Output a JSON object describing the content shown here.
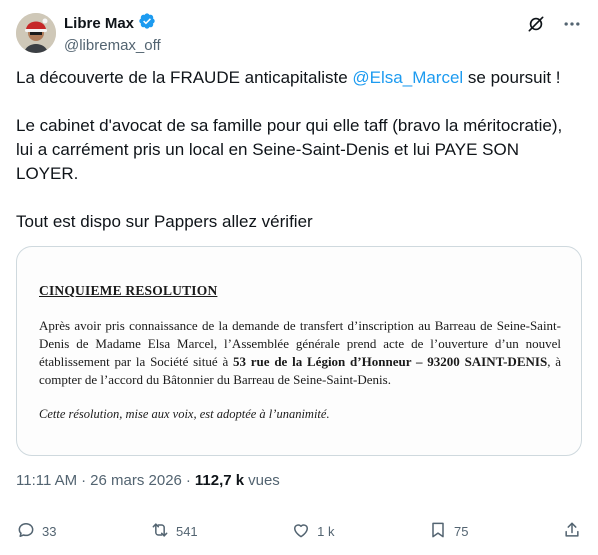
{
  "author": {
    "name": "Libre Max",
    "handle": "@libremax_off",
    "verified": true
  },
  "tweet": {
    "line1_pre": "La découverte de la FRAUDE anticapitaliste ",
    "line1_mention": "@Elsa_Marcel",
    "line1_post": " se poursuit !",
    "para2": "Le cabinet d'avocat de sa famille pour qui elle taff (bravo la méritocratie), lui a carrément pris un local en Seine-Saint-Denis et lui PAYE SON LOYER.",
    "para3": "Tout est dispo sur Pappers allez vérifier"
  },
  "document": {
    "title": "CINQUIEME RESOLUTION",
    "body_pre": "Après avoir pris connaissance de la demande de transfert d’inscription au Barreau de Seine-Saint-Denis de Madame Elsa Marcel, l’Assemblée générale prend acte de l’ouverture d’un nouvel établissement par la Société situé à ",
    "body_bold": "53 rue de la Légion d’Honneur – 93200 SAINT-DENIS",
    "body_post": ", à compter de l’accord du Bâtonnier du Barreau de Seine-Saint-Denis.",
    "vote": "Cette résolution, mise aux voix, est adoptée à l’unanimité."
  },
  "meta": {
    "time": "11:11 AM",
    "separator": "·",
    "date": "26 mars 2026",
    "views_count": "112,7 k",
    "views_label": "vues"
  },
  "actions": {
    "replies": "33",
    "reposts": "541",
    "likes": "1 k",
    "bookmarks": "75"
  },
  "colors": {
    "accent": "#1d9bf0",
    "secondary_text": "#536471",
    "primary_text": "#0f1419",
    "border": "#cfd9de"
  }
}
